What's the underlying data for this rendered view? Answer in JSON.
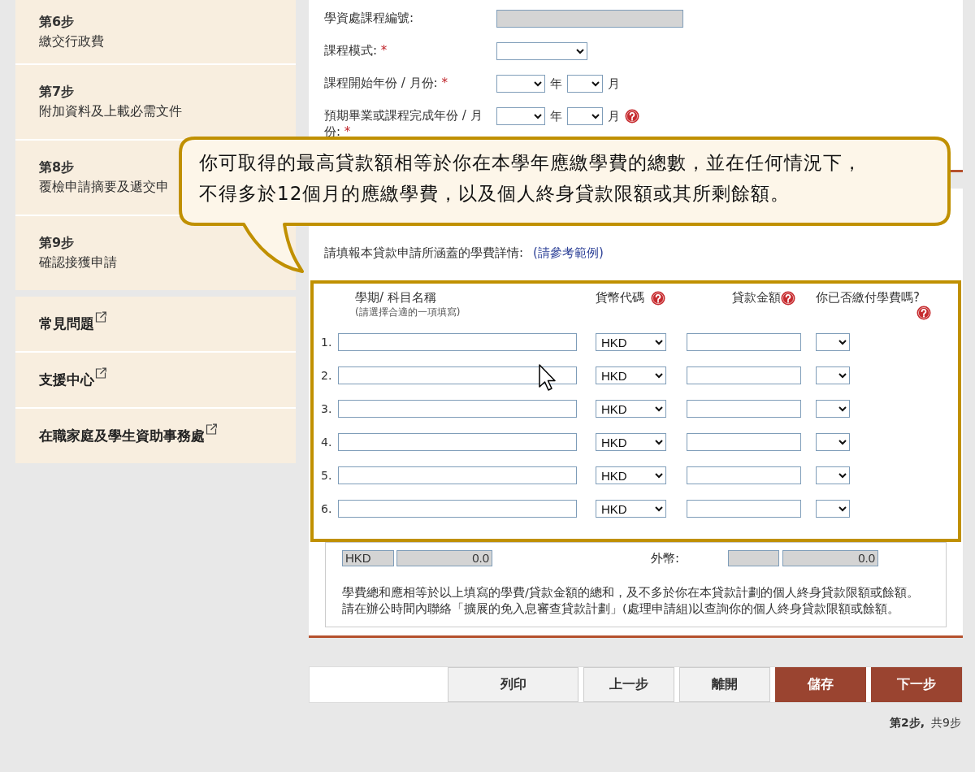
{
  "sidebar": {
    "steps": [
      {
        "step": "第6步",
        "title": "繳交行政費"
      },
      {
        "step": "第7步",
        "title": "附加資料及上載必需文件"
      },
      {
        "step": "第8步",
        "title": "覆檢申請摘要及遞交申"
      },
      {
        "step": "第9步",
        "title": "確認接獲申請"
      }
    ],
    "links": [
      {
        "label": "常見問題"
      },
      {
        "label": "支援中心"
      },
      {
        "label": "在職家庭及學生資助事務處"
      }
    ]
  },
  "course_fields": [
    {
      "label": "學資處課程編號:",
      "kind": "readonly"
    },
    {
      "label": "課程模式:",
      "required_mark": "*",
      "kind": "select"
    },
    {
      "label": "課程開始年份 / 月份:",
      "required_mark": "*",
      "kind": "year_month",
      "year_unit": "年",
      "month_unit": "月",
      "help": false
    },
    {
      "label": "預期畢業或課程完成年份 / 月份:",
      "required_mark": "*",
      "kind": "year_month",
      "year_unit": "年",
      "month_unit": "月",
      "help": true
    }
  ],
  "tooltip": {
    "lines": [
      "你可取得的最高貸款額相等於你在本學年應繳學費的總數，並在任何情況下，",
      "不得多於12個月的應繳學費，以及個人終身貸款限額或其所剩餘額。"
    ]
  },
  "loan_section": {
    "instruction": "請填報本貸款申請所涵蓋的學費詳情:",
    "example_link": "(請參考範例)",
    "columns": [
      {
        "label": "學期/ 科目名稱",
        "sublabel": "(請選擇合適的一項填寫)",
        "help": false
      },
      {
        "label": "貨幣代碼",
        "help": true
      },
      {
        "label": "貸款金額",
        "help": true
      },
      {
        "label": "你已否繳付學費嗎?",
        "help": true
      }
    ],
    "rows": [
      {
        "number": "1.",
        "currency": "HKD"
      },
      {
        "number": "2.",
        "currency": "HKD"
      },
      {
        "number": "3.",
        "currency": "HKD"
      },
      {
        "number": "4.",
        "currency": "HKD"
      },
      {
        "number": "5.",
        "currency": "HKD"
      },
      {
        "number": "6.",
        "currency": "HKD"
      }
    ],
    "totals": {
      "currency": "HKD",
      "amount": "0.0",
      "foreign_label": "外幣:",
      "foreign_amount": "0.0"
    },
    "note": "學費總和應相等於以上填寫的學費/貸款金額的總和，及不多於你在本貸款計劃的個人終身貸款限額或餘額。請在辦公時間內聯絡「擴展的免入息審查貸款計劃」(處理申請組)以查詢你的個人終身貸款限額或餘額。"
  },
  "buttons": [
    {
      "label": "列印",
      "kind": "secondary"
    },
    {
      "label": "上一步",
      "kind": "secondary"
    },
    {
      "label": "離開",
      "kind": "secondary"
    },
    {
      "label": "儲存",
      "kind": "primary"
    },
    {
      "label": "下一步",
      "kind": "primary"
    }
  ],
  "step_indicator": {
    "current": "第2步,",
    "total": "共9步"
  }
}
